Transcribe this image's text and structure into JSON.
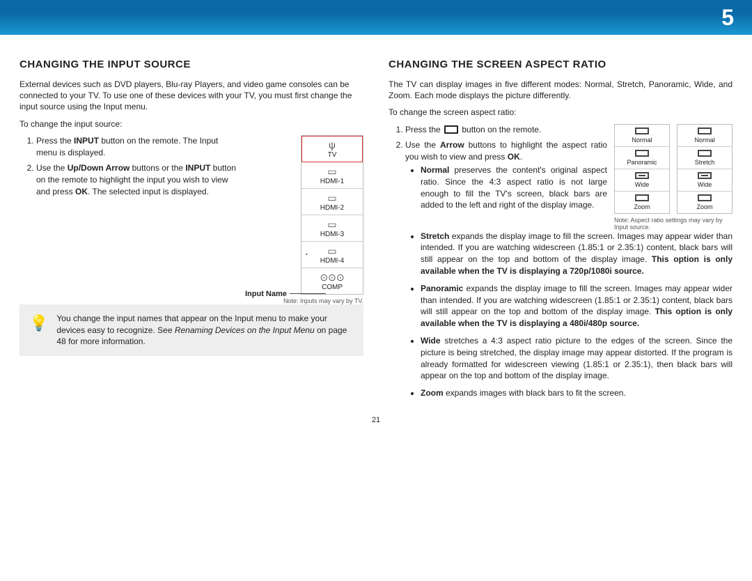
{
  "pageNumber": "5",
  "left": {
    "heading": "CHANGING THE INPUT SOURCE",
    "intro": "External devices such as DVD players, Blu-ray Players, and video game consoles can be connected to your TV. To use one of these devices with your TV, you must first change the input source using the Input menu.",
    "intro2": "To change the input source:",
    "step1a": "Press the ",
    "step1b": "INPUT",
    "step1c": " button on the remote. The Input menu is displayed.",
    "step2a": "Use the ",
    "step2b": "Up/Down Arrow",
    "step2c": " buttons or the ",
    "step2d": "INPUT",
    "step2e": " button on the remote to highlight the input you wish to view and press ",
    "step2f": "OK",
    "step2g": ". The selected input is displayed.",
    "inputLabel": "Input Name",
    "inputs": [
      "TV",
      "HDMI-1",
      "HDMI-2",
      "HDMI-3",
      "HDMI-4",
      "COMP"
    ],
    "inputNote": "Note: Inputs may vary by TV.",
    "tipA": "You change the input names that appear on the Input menu to make your devices easy to recognize. See ",
    "tipB": "Renaming Devices on the Input Menu",
    "tipC": " on page 48 for more information."
  },
  "right": {
    "heading": "CHANGING THE SCREEN ASPECT RATIO",
    "intro": "The TV can display images in five different modes: Normal, Stretch, Panoramic, Wide, and Zoom. Each mode displays the picture differently.",
    "intro2": "To change the screen aspect ratio:",
    "step1a": "Press the ",
    "step1b": " button on the remote.",
    "step2a": "Use the ",
    "step2b": "Arrow",
    "step2c": " buttons to highlight the aspect ratio you wish to view and press ",
    "step2d": "OK",
    "step2e": ".",
    "modesCol1": [
      "Normal",
      "Panoramic",
      "Wide",
      "Zoom"
    ],
    "modesCol2": [
      "Normal",
      "Stretch",
      "Wide",
      "Zoom"
    ],
    "aspectNote": "Note: Aspect ratio settings may vary by Input source.",
    "normalT": "Normal",
    "normalD": " preserves the content's original aspect ratio. Since the 4:3 aspect ratio is not large enough to fill the TV's screen, black bars are added to the left and right of the display image.",
    "stretchT": "Stretch",
    "stretchD": " expands the display image to fill the screen. Images may appear wider than intended. If you are watching widescreen (1.85:1 or 2.35:1) content, black bars will still appear on the top and bottom of the display image. ",
    "stretchB": "This option is only available when the TV is displaying a 720p/1080i source.",
    "panoT": "Panoramic",
    "panoD": " expands the display image to fill the screen. Images may appear wider than intended. If you are watching widescreen (1.85:1 or 2.35:1) content, black bars will still appear on the top and bottom of the display image. ",
    "panoB": "This option is only available when the TV is displaying a 480i/480p source.",
    "wideT": "Wide",
    "wideD": " stretches a 4:3 aspect ratio picture to the edges of the screen. Since the picture is being stretched, the display image may appear distorted. If the program is already formatted for widescreen viewing (1.85:1 or 2.35:1), then black bars will appear on the top and bottom of the display image.",
    "zoomT": "Zoom",
    "zoomD": " expands images with black bars to fit the screen."
  },
  "footerPage": "21"
}
